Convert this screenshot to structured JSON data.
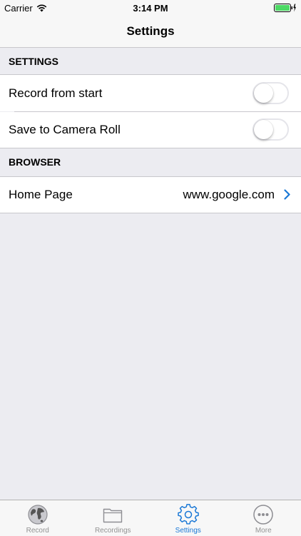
{
  "status_bar": {
    "carrier": "Carrier",
    "time": "3:14 PM"
  },
  "nav": {
    "title": "Settings"
  },
  "sections": [
    {
      "header": "SETTINGS",
      "rows": [
        {
          "label": "Record from start",
          "toggle": false
        },
        {
          "label": "Save to Camera Roll",
          "toggle": false
        }
      ]
    },
    {
      "header": "BROWSER",
      "rows": [
        {
          "label": "Home Page",
          "value": "www.google.com"
        }
      ]
    }
  ],
  "tabs": [
    {
      "label": "Record",
      "icon": "globe-icon"
    },
    {
      "label": "Recordings",
      "icon": "folder-icon"
    },
    {
      "label": "Settings",
      "icon": "gear-icon",
      "active": true
    },
    {
      "label": "More",
      "icon": "more-icon"
    }
  ],
  "colors": {
    "accent": "#1a78d6",
    "battery": "#4cd964",
    "group_background": "#ececf1"
  }
}
